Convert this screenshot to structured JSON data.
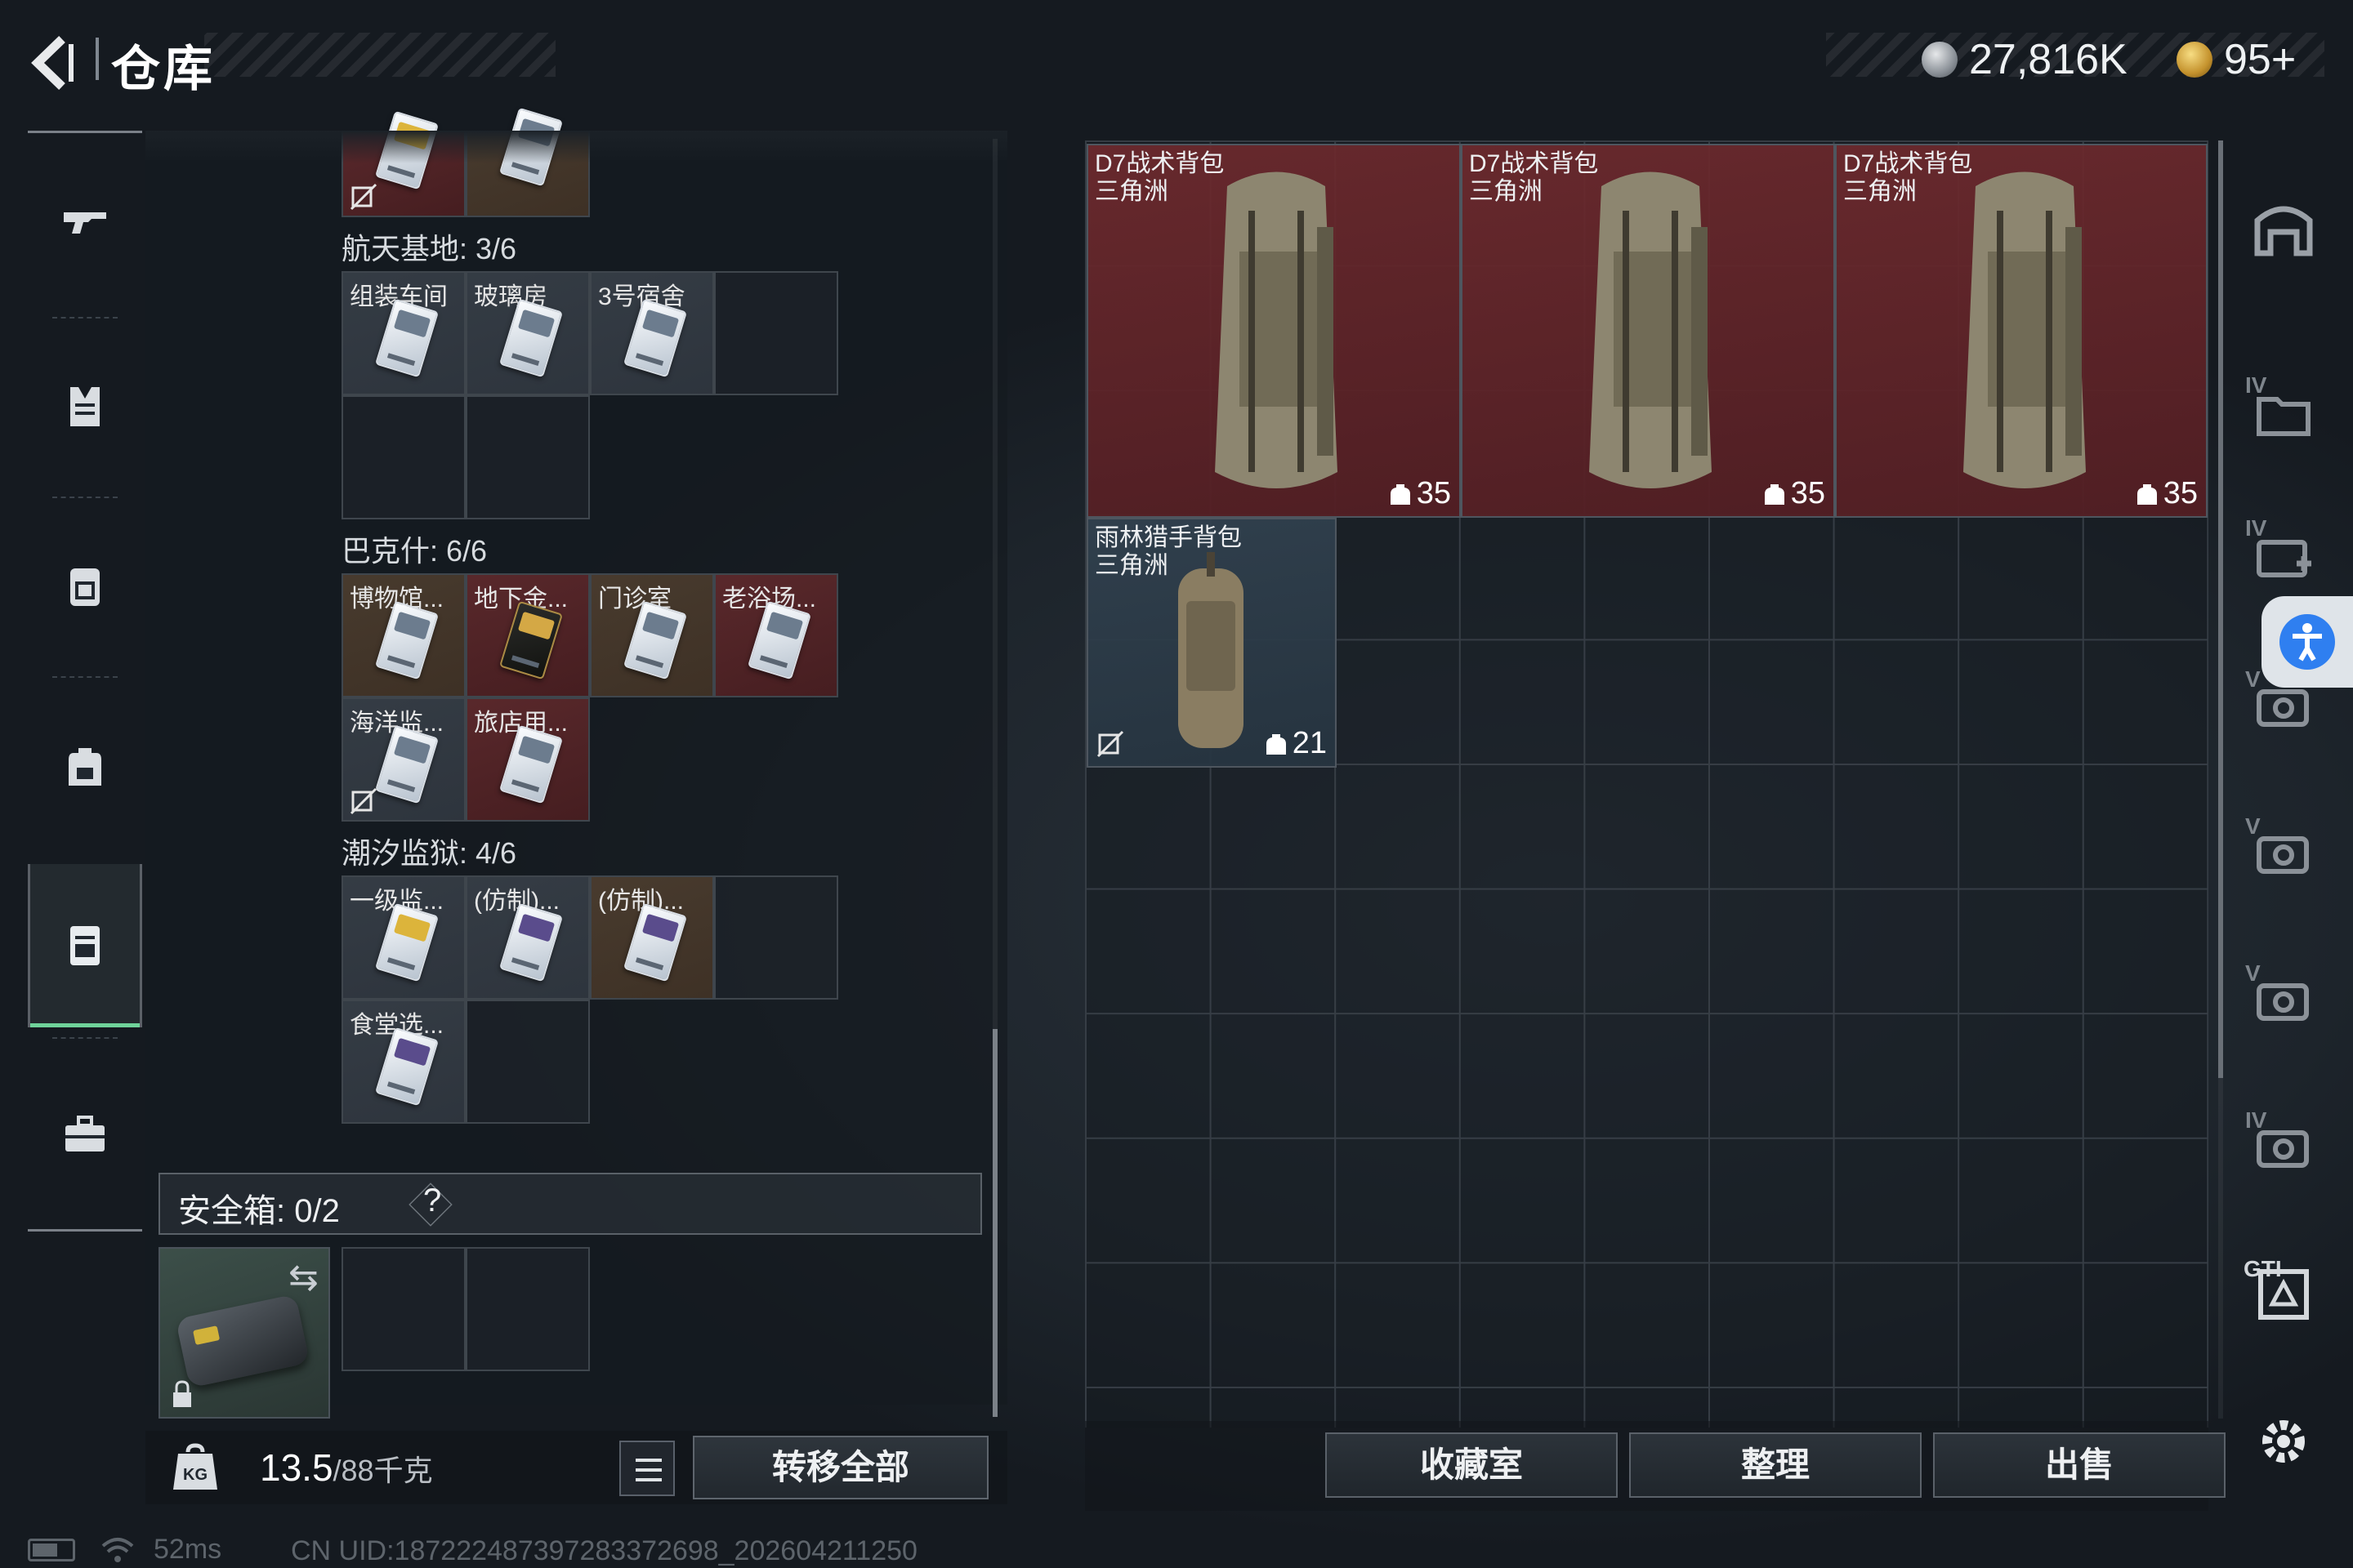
{
  "header": {
    "title": "仓库",
    "currency1_value": "27,816K",
    "currency2_value": "95+",
    "currency1_icon": "silver-coin-icon",
    "currency2_icon": "gold-triangle-coin-icon"
  },
  "sidebar": {
    "items": [
      {
        "name": "weapon",
        "icon": "gun-icon"
      },
      {
        "name": "armor",
        "icon": "vest-icon"
      },
      {
        "name": "chest-rig",
        "icon": "rig-icon"
      },
      {
        "name": "backpack",
        "icon": "backpack-icon"
      },
      {
        "name": "keys",
        "icon": "keycard-case-icon",
        "active": true
      },
      {
        "name": "case",
        "icon": "briefcase-icon"
      }
    ]
  },
  "key_sections": [
    {
      "label": "航天基地: 3/6",
      "slots": [
        "组装车间",
        "玻璃房",
        "3号宿舍"
      ]
    },
    {
      "label": "巴克什: 6/6",
      "slots": [
        "博物馆...",
        "地下金...",
        "门诊室",
        "老浴场...",
        "海洋监...",
        "旅店用..."
      ]
    },
    {
      "label": "潮汐监狱: 4/6",
      "slots": [
        "一级监...",
        "(仿制)...",
        "(仿制)...",
        "食堂选..."
      ]
    }
  ],
  "safe_box": {
    "label": "安全箱:",
    "count": "0/2",
    "help": "?"
  },
  "bottom_left": {
    "weight": "13.5",
    "weight_unit": "/88千克",
    "transfer_all": "转移全部"
  },
  "status_bar": {
    "ping": "52ms",
    "uid": "CN UID:18722248739728337269​8_202604211250"
  },
  "backpacks": [
    {
      "name": "D7战术背包",
      "sub": "三角洲",
      "capacity": "35"
    },
    {
      "name": "D7战术背包",
      "sub": "三角洲",
      "capacity": "35"
    },
    {
      "name": "D7战术背包",
      "sub": "三角洲",
      "capacity": "35"
    },
    {
      "name": "雨林猎手背包",
      "sub": "三角洲",
      "capacity": "21"
    }
  ],
  "actions": {
    "collection": "收藏室",
    "organize": "整理",
    "sell": "出售"
  },
  "rail": {
    "icons": [
      "warehouse-icon",
      "folder-iv-icon",
      "medkit-iv-icon",
      "gear-v-icon",
      "gear-v-icon",
      "gear-v-icon",
      "gear-iv-icon",
      "gti-chip-icon",
      "settings-icon"
    ],
    "levels": [
      "IV",
      "IV",
      "V",
      "V",
      "V",
      "IV",
      "GTI"
    ]
  },
  "colors": {
    "active_green": "#6fd39a",
    "rare_red": "#6e2a2e",
    "accessibility_blue": "#2f7ff0"
  }
}
